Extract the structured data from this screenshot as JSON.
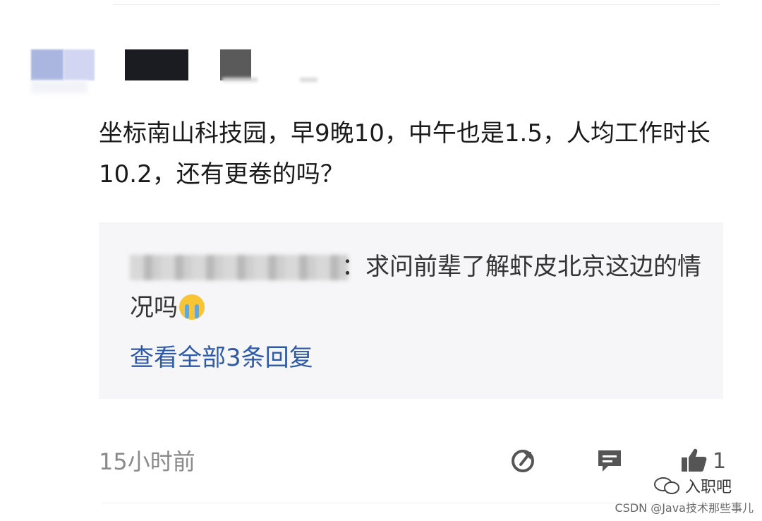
{
  "comment": {
    "text": "坐标南山科技园，早9晚10，中午也是1.5，人均工作时长10.2，还有更卷的吗？",
    "reply": {
      "text": "：求问前辈了解虾皮北京这边的情况吗",
      "emoji": "loudly-crying-face",
      "view_all": "查看全部3条回复"
    },
    "time": "15小时前",
    "actions": {
      "share_icon": "share-icon",
      "comment_icon": "comment-icon",
      "like_icon": "thumbs-up-icon",
      "like_count": "1"
    }
  },
  "watermarks": {
    "wechat": "入职吧",
    "csdn": "CSDN @Java技术那些事儿"
  },
  "colors": {
    "link": "#2d5aa8",
    "reply_bg": "#f6f6f8",
    "muted": "#8a8a8a"
  }
}
